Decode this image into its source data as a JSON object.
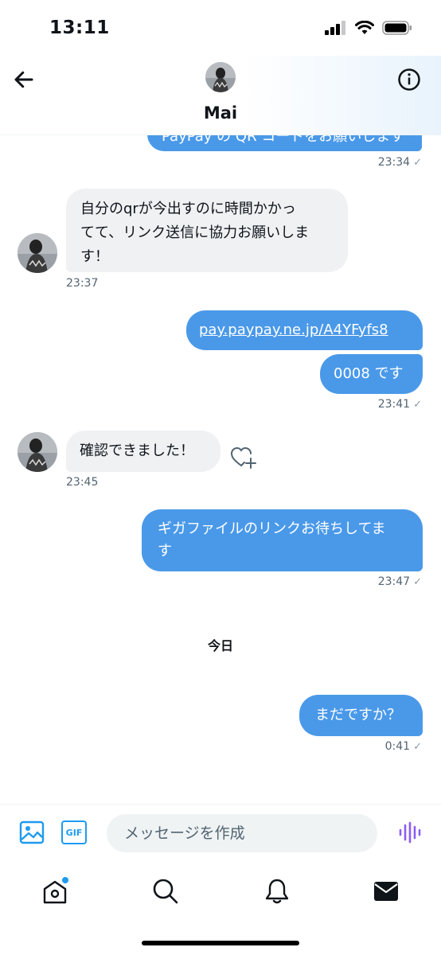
{
  "status": {
    "time": "13:11"
  },
  "header": {
    "name": "Mai"
  },
  "messages": {
    "m1_partial": "PayPay の QR コードをお願いします",
    "m1_time": "23:34",
    "m2_text": "自分のqrが今出すのに時間かかってて、リンク送信に協力お願いします！",
    "m2_line1": "自分のqrが今出すのに時間かかっ",
    "m2_line2": "てて、リンク送信に協力お願いしま",
    "m2_line3": "す！",
    "m2_time": "23:37",
    "m3_link": "pay.paypay.ne.jp/A4YFyfs8",
    "m4_text": "0008 です",
    "m34_time": "23:41",
    "m5_text": "確認できました！",
    "m5_time": "23:45",
    "m6_line1": "ギガファイルのリンクお待ちしてま",
    "m6_line2": "す",
    "m6_time": "23:47",
    "date_divider": "今日",
    "m7_text": "まだですか？",
    "m7_time": "0:41",
    "tick": "✓"
  },
  "composer": {
    "placeholder": "メッセージを作成",
    "gif_label": "GIF"
  },
  "colors": {
    "accent": "#1d9bf0",
    "bubble_out": "#4a99e9",
    "bubble_in": "#eff1f3",
    "voice": "#8b5cf6"
  },
  "icons": {
    "back": "arrow-left-icon",
    "info": "info-icon",
    "image": "image-icon",
    "gif": "gif-icon",
    "voice": "voice-wave-icon",
    "home": "home-icon",
    "search": "search-icon",
    "notifications": "bell-icon",
    "messages": "mail-icon",
    "react": "heart-plus-icon"
  }
}
